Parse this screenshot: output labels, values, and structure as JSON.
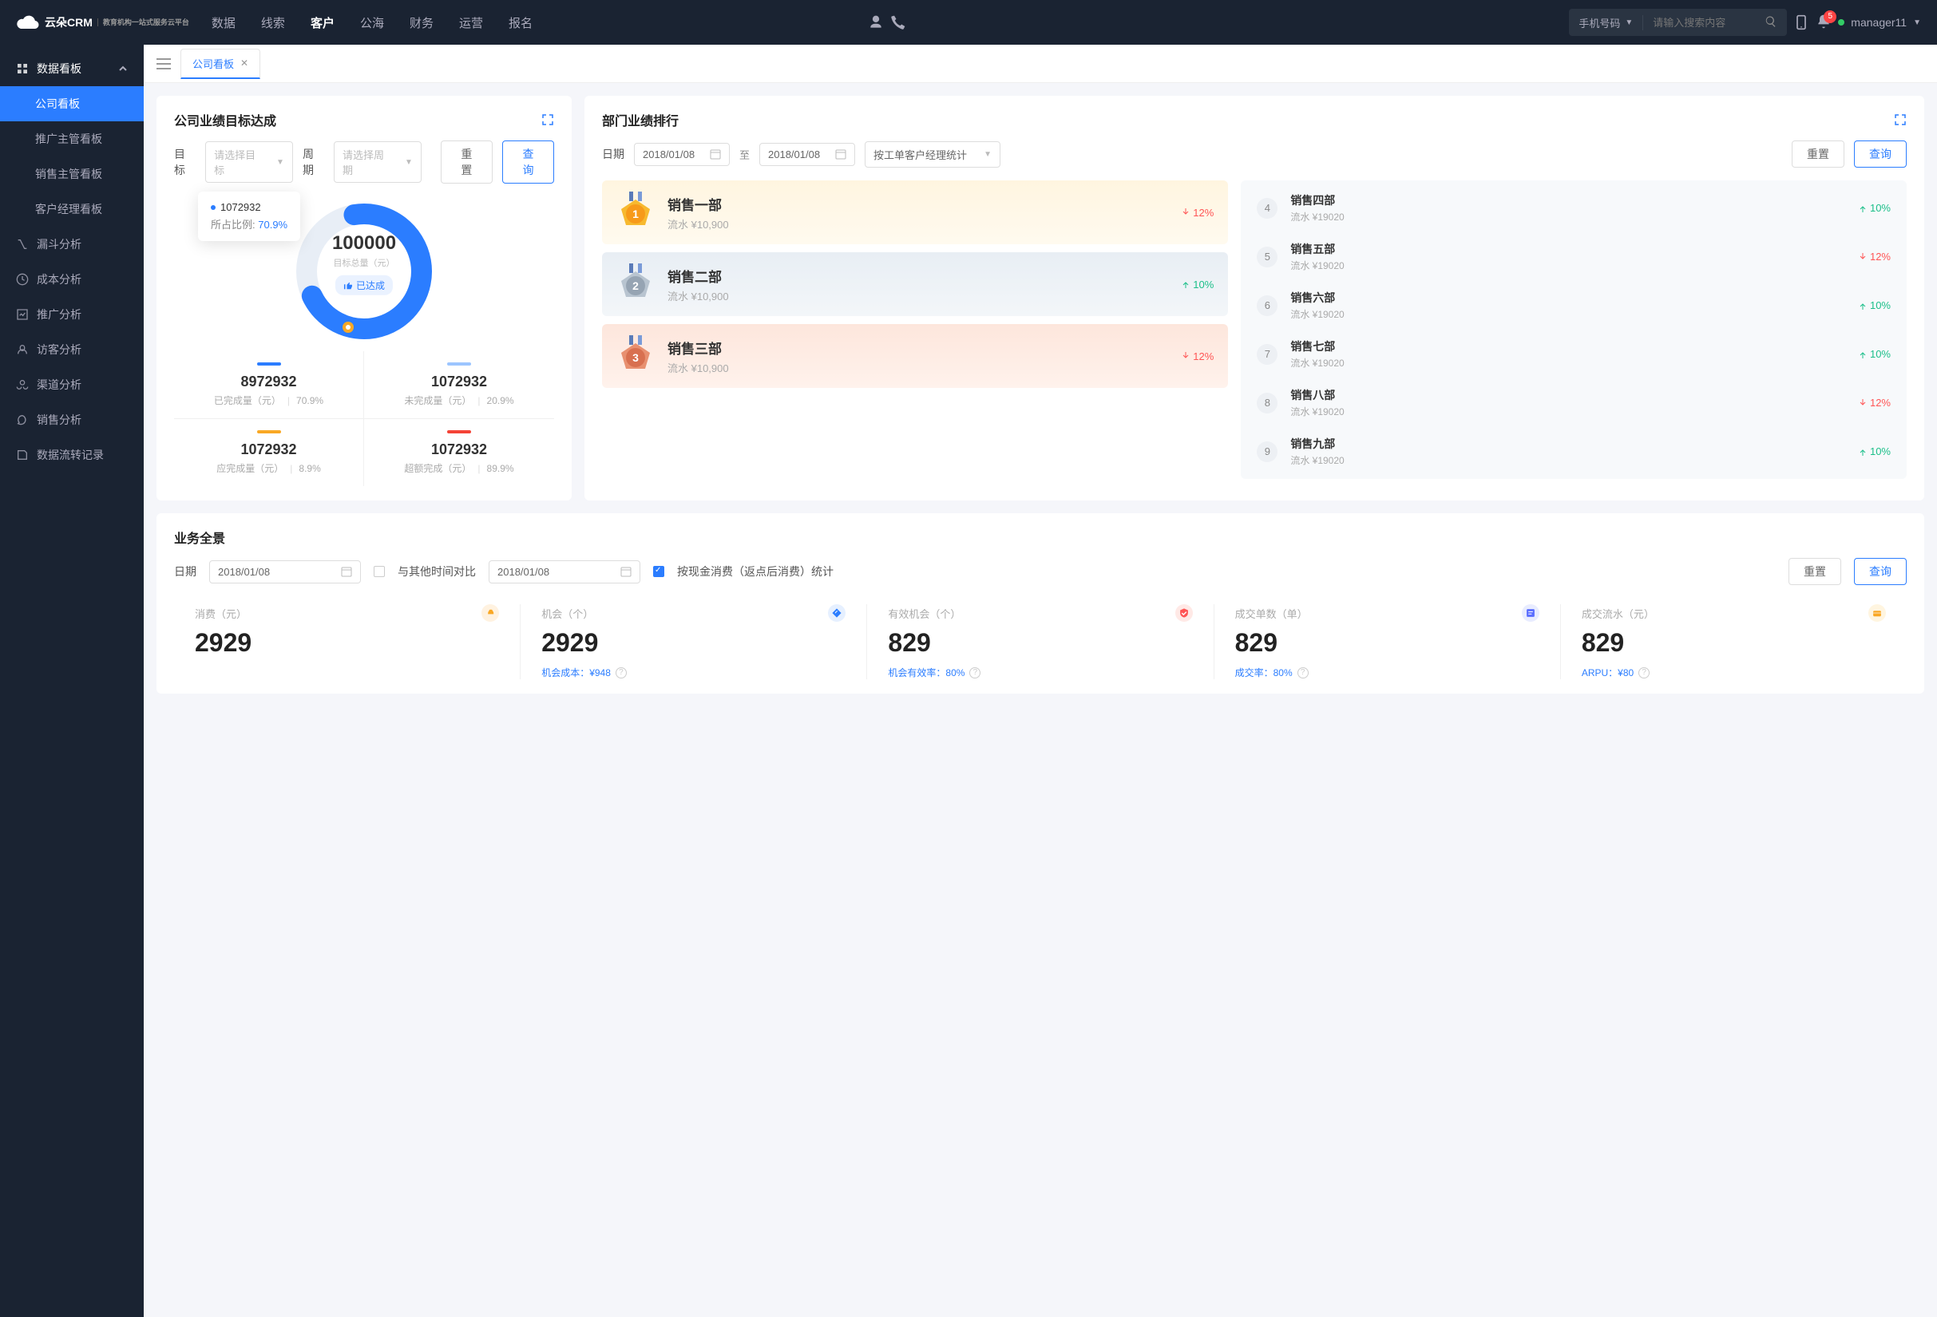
{
  "topbar": {
    "brand": "云朵CRM",
    "brand_sub": "教育机构一站式服务云平台",
    "nav": [
      "数据",
      "线索",
      "客户",
      "公海",
      "财务",
      "运营",
      "报名"
    ],
    "nav_active": 2,
    "search_type": "手机号码",
    "search_placeholder": "请输入搜索内容",
    "badge": "5",
    "user": "manager11"
  },
  "sidebar": {
    "group": "数据看板",
    "group_items": [
      "公司看板",
      "推广主管看板",
      "销售主管看板",
      "客户经理看板"
    ],
    "group_active": 0,
    "items": [
      "漏斗分析",
      "成本分析",
      "推广分析",
      "访客分析",
      "渠道分析",
      "销售分析",
      "数据流转记录"
    ]
  },
  "tab": {
    "label": "公司看板"
  },
  "goal": {
    "title": "公司业绩目标达成",
    "label_target": "目标",
    "sel_target": "请选择目标",
    "label_period": "周期",
    "sel_period": "请选择周期",
    "btn_reset": "重置",
    "btn_query": "查询",
    "tooltip_val": "1072932",
    "tooltip_label": "所占比例:",
    "tooltip_pct": "70.9%",
    "center_val": "100000",
    "center_label": "目标总量（元）",
    "chip": "已达成",
    "stats": [
      {
        "val": "8972932",
        "label": "已完成量（元）",
        "pct": "70.9%",
        "color": "u-blue"
      },
      {
        "val": "1072932",
        "label": "未完成量（元）",
        "pct": "20.9%",
        "color": "u-lblue"
      },
      {
        "val": "1072932",
        "label": "应完成量（元）",
        "pct": "8.9%",
        "color": "u-orange"
      },
      {
        "val": "1072932",
        "label": "超额完成（元）",
        "pct": "89.9%",
        "color": "u-red"
      }
    ]
  },
  "rank": {
    "title": "部门业绩排行",
    "label_date": "日期",
    "date1": "2018/01/08",
    "zhi": "至",
    "date2": "2018/01/08",
    "sel_stat": "按工单客户经理统计",
    "btn_reset": "重置",
    "btn_query": "查询",
    "top3": [
      {
        "name": "销售一部",
        "sub": "流水 ¥10,900",
        "pct": "12%",
        "dir": "down"
      },
      {
        "name": "销售二部",
        "sub": "流水 ¥10,900",
        "pct": "10%",
        "dir": "up"
      },
      {
        "name": "销售三部",
        "sub": "流水 ¥10,900",
        "pct": "12%",
        "dir": "down"
      }
    ],
    "rest": [
      {
        "n": "4",
        "name": "销售四部",
        "sub": "流水 ¥19020",
        "pct": "10%",
        "dir": "up"
      },
      {
        "n": "5",
        "name": "销售五部",
        "sub": "流水 ¥19020",
        "pct": "12%",
        "dir": "down"
      },
      {
        "n": "6",
        "name": "销售六部",
        "sub": "流水 ¥19020",
        "pct": "10%",
        "dir": "up"
      },
      {
        "n": "7",
        "name": "销售七部",
        "sub": "流水 ¥19020",
        "pct": "10%",
        "dir": "up"
      },
      {
        "n": "8",
        "name": "销售八部",
        "sub": "流水 ¥19020",
        "pct": "12%",
        "dir": "down"
      },
      {
        "n": "9",
        "name": "销售九部",
        "sub": "流水 ¥19020",
        "pct": "10%",
        "dir": "up"
      }
    ]
  },
  "panorama": {
    "title": "业务全景",
    "label_date": "日期",
    "date1": "2018/01/08",
    "compare_label": "与其他时间对比",
    "date2": "2018/01/08",
    "opt_label": "按现金消费（返点后消费）统计",
    "btn_reset": "重置",
    "btn_query": "查询",
    "kpis": [
      {
        "label": "消费（元）",
        "val": "2929",
        "sub": "",
        "iconcls": "kd-orange"
      },
      {
        "label": "机会（个）",
        "val": "2929",
        "sub": "机会成本：¥948",
        "iconcls": "kd-blue"
      },
      {
        "label": "有效机会（个）",
        "val": "829",
        "sub": "机会有效率：80%",
        "iconcls": "kd-red"
      },
      {
        "label": "成交单数（单）",
        "val": "829",
        "sub": "成交率：80%",
        "iconcls": "kd-purple"
      },
      {
        "label": "成交流水（元）",
        "val": "829",
        "sub": "ARPU：¥80",
        "iconcls": "kd-yellow"
      }
    ]
  },
  "chart_data": {
    "type": "pie",
    "title": "目标总量（元）",
    "total": 100000,
    "series": [
      {
        "name": "已完成量",
        "value": 8972932,
        "pct": 70.9
      },
      {
        "name": "未完成量",
        "value": 1072932,
        "pct": 20.9
      },
      {
        "name": "应完成量",
        "value": 1072932,
        "pct": 8.9
      },
      {
        "name": "超额完成",
        "value": 1072932,
        "pct": 89.9
      }
    ]
  }
}
